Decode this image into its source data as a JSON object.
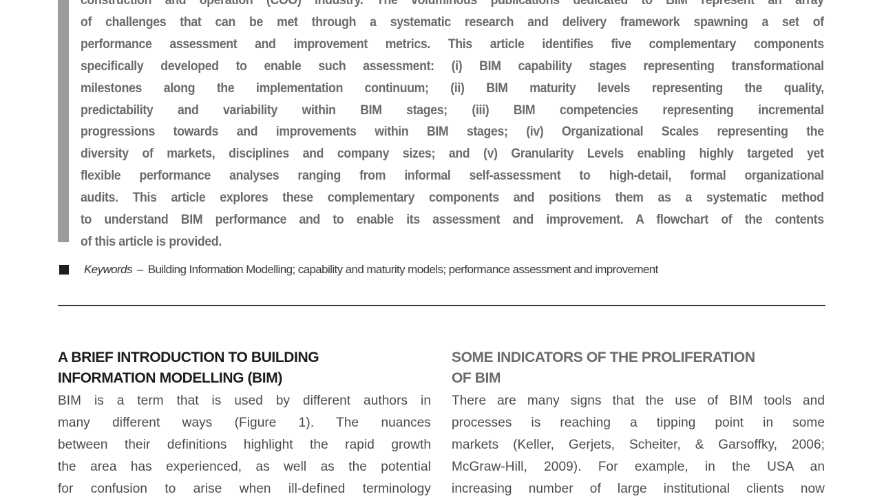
{
  "abstract": {
    "lines": [
      "construction and operation (COO) industry. The voluminous publications dedicated to BIM represent an array",
      "of challenges that can be met through a systematic research and delivery framework spawning a set of",
      "performance assessment and improvement metrics. This article identifies five complementary components",
      "specifically developed to enable such assessment: (i) BIM capability stages representing transformational",
      "milestones along the implementation continuum; (ii) BIM maturity levels representing the quality,",
      "predictability and variability within BIM stages; (iii) BIM competencies representing incremental",
      "progressions towards and improvements within BIM stages; (iv) Organizational Scales representing the",
      "diversity of markets, disciplines and company sizes; and (v) Granularity Levels enabling highly targeted yet",
      "flexible performance analyses ranging from informal self-assessment to high-detail, formal organizational",
      "audits. This article explores these complementary components and positions them as a systematic method",
      "to understand BIM performance and to enable its assessment and improvement. A flowchart of the contents",
      "of this article is provided."
    ]
  },
  "keywords": {
    "label": "Keywords",
    "dash": "–",
    "text": "Building Information Modelling; capability and maturity models; performance assessment and improvement"
  },
  "sections": [
    {
      "heading_lines": [
        "A BRIEF INTRODUCTION TO BUILDING",
        "INFORMATION MODELLING (BIM)"
      ],
      "body_lines": [
        "BIM is a term that is used by different authors in",
        "many different ways (Figure 1). The nuances",
        "between their definitions highlight the rapid growth",
        "the area has experienced, as well as the potential",
        "for confusion to arise when ill-defined terminology"
      ]
    },
    {
      "heading_lines": [
        "SOME INDICATORS OF THE PROLIFERATION",
        "OF BIM"
      ],
      "body_lines": [
        "There are many signs that the use of BIM tools and",
        "processes is reaching a tipping point in some",
        "markets (Keller, Gerjets, Scheiter, & Garsoffky, 2006;",
        "McGraw-Hill, 2009). For example, in the USA an",
        "increasing number of large institutional clients now"
      ]
    }
  ]
}
